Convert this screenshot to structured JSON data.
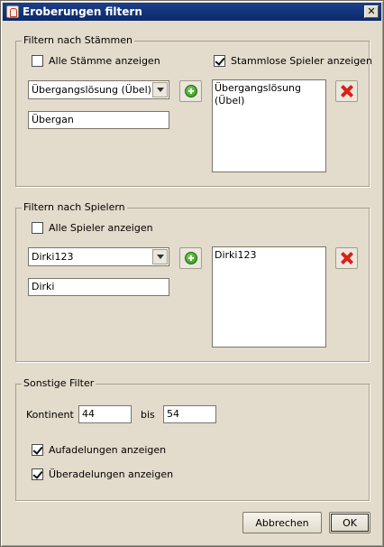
{
  "window": {
    "title": "Eroberungen filtern",
    "close_glyph": "✕"
  },
  "tribes": {
    "legend": "Filtern nach Stämmen",
    "show_all_label": "Alle Stämme anzeigen",
    "show_all_checked": false,
    "show_tribeless_label": "Stammlose Spieler anzeigen",
    "show_tribeless_checked": true,
    "combo_value": "Übergangslösung (Übel)",
    "search_value": "Übergan",
    "list_items": [
      "Übergangslösung (Übel)"
    ]
  },
  "players": {
    "legend": "Filtern nach Spielern",
    "show_all_label": "Alle Spieler anzeigen",
    "show_all_checked": false,
    "combo_value": "Dirki123",
    "search_value": "Dirki",
    "list_items": [
      "Dirki123"
    ]
  },
  "other": {
    "legend": "Sonstige Filter",
    "continent_label": "Kontinent",
    "continent_from": "44",
    "to_label": "bis",
    "continent_to": "54",
    "show_ennoblements_label": "Aufadelungen anzeigen",
    "show_ennoblements_checked": true,
    "show_over_ennoblements_label": "Überadelungen anzeigen",
    "show_over_ennoblements_checked": true
  },
  "footer": {
    "cancel_label": "Abbrechen",
    "ok_label": "OK"
  },
  "icons": {
    "add": "plus-icon",
    "remove": "delete-icon"
  }
}
